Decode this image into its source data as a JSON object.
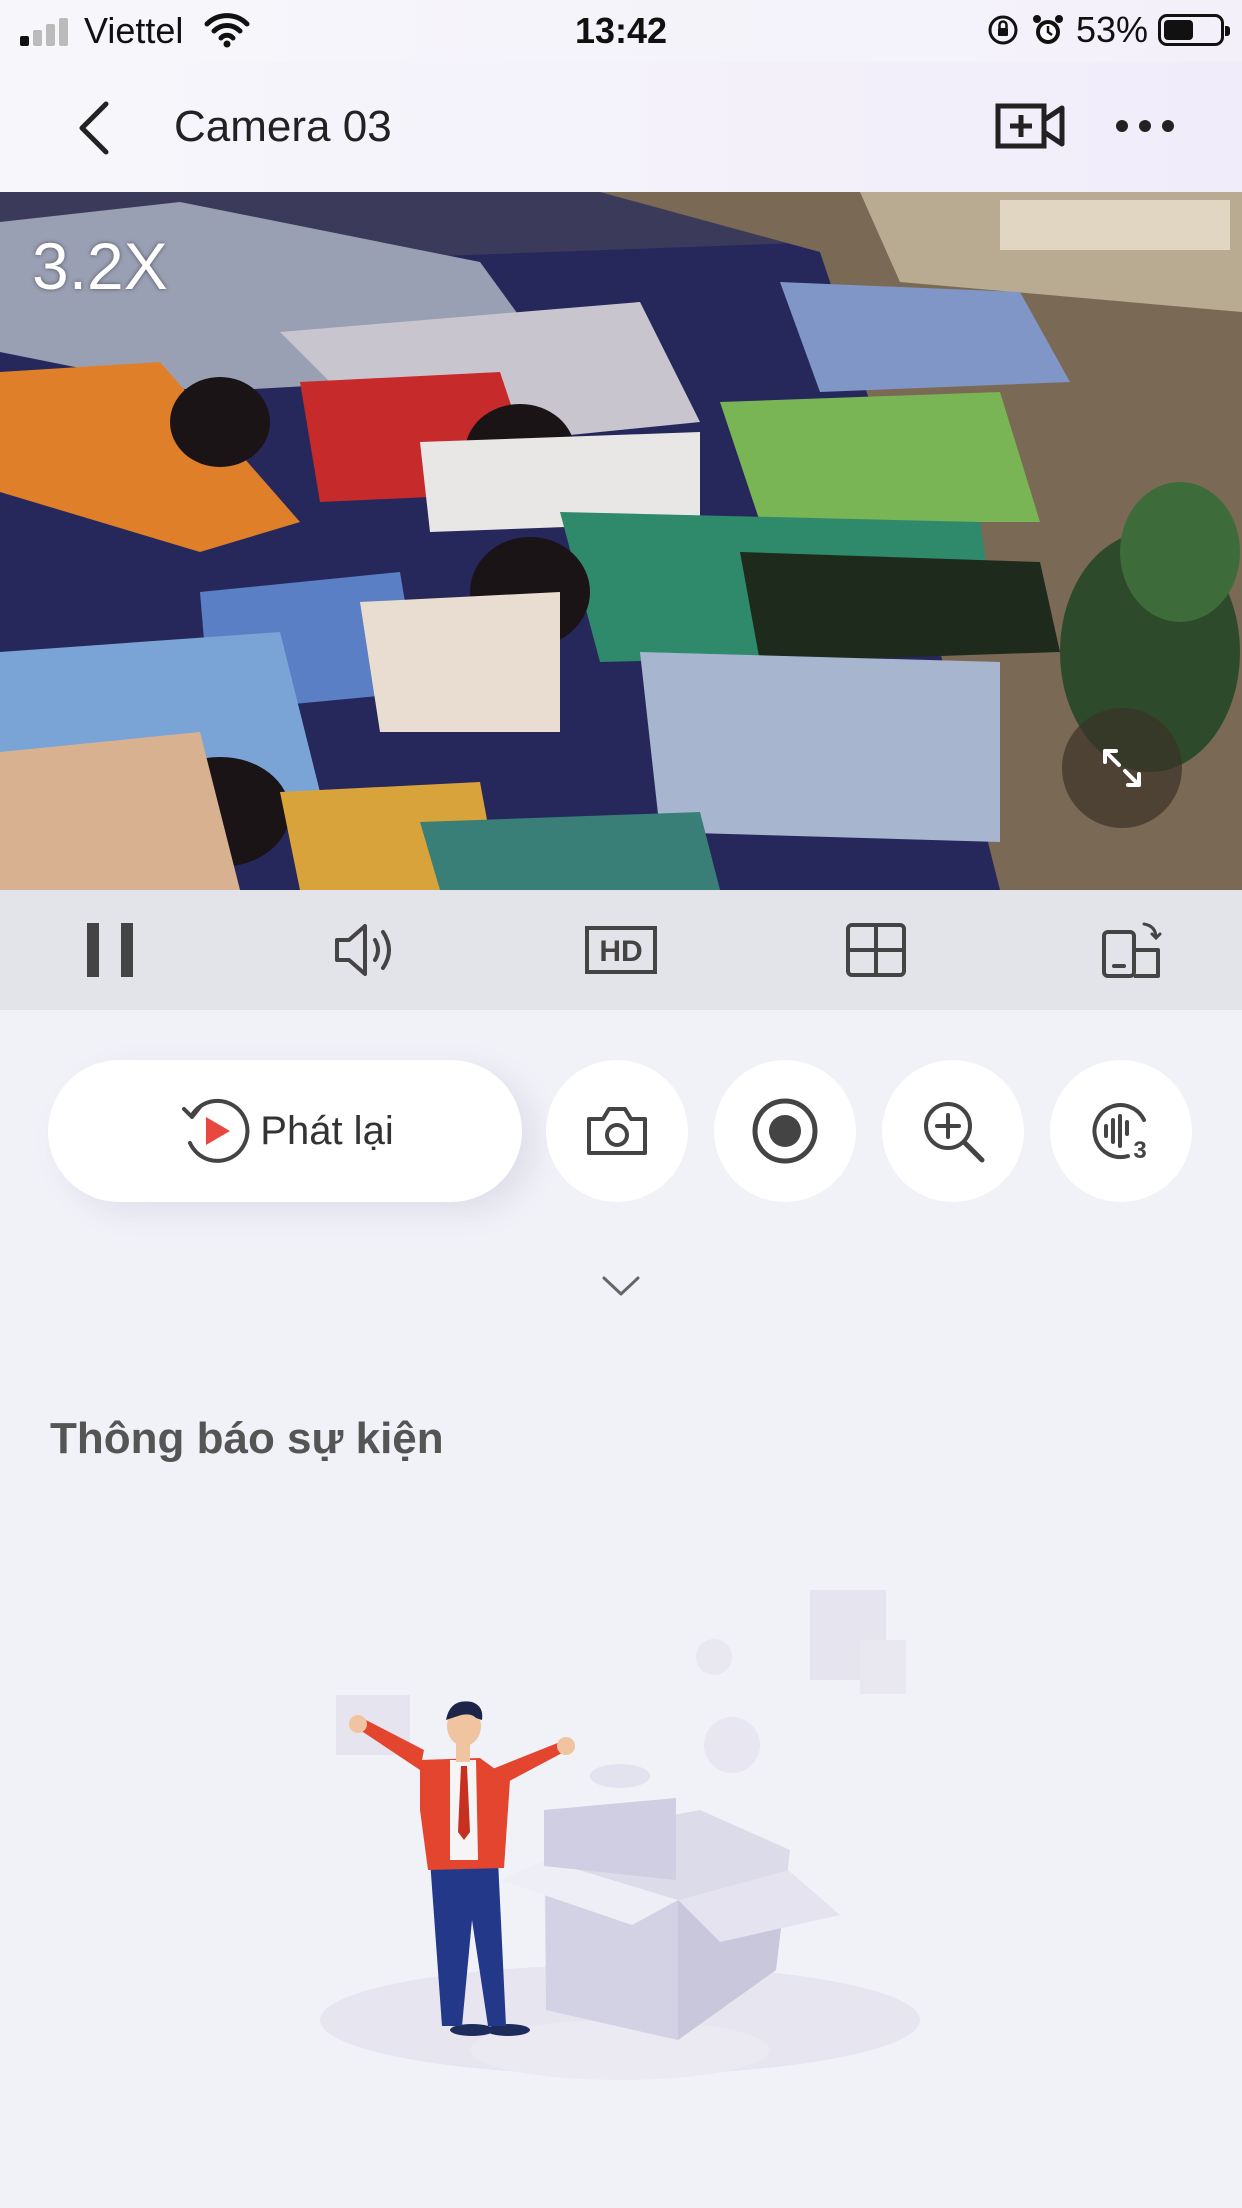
{
  "status_bar": {
    "carrier": "Viettel",
    "time": "13:42",
    "battery": "53%",
    "battery_level": 0.53
  },
  "header": {
    "title": "Camera 03"
  },
  "video": {
    "zoom_level": "3.2X"
  },
  "controls": {
    "icons": [
      "pause-icon",
      "volume-icon",
      "hd-icon",
      "grid-icon",
      "rotate-screen-icon"
    ],
    "hd_label": "HD"
  },
  "actions": {
    "playback_label": "Phát lại",
    "icons": [
      "camera-snapshot-icon",
      "record-icon",
      "zoom-in-icon",
      "talk-icon"
    ],
    "talk_badge": "3"
  },
  "events": {
    "section_title": "Thông báo sự kiện"
  },
  "colors": {
    "accent_red": "#e8483f",
    "icon_gray": "#444444",
    "background": "#f1f1f8"
  }
}
